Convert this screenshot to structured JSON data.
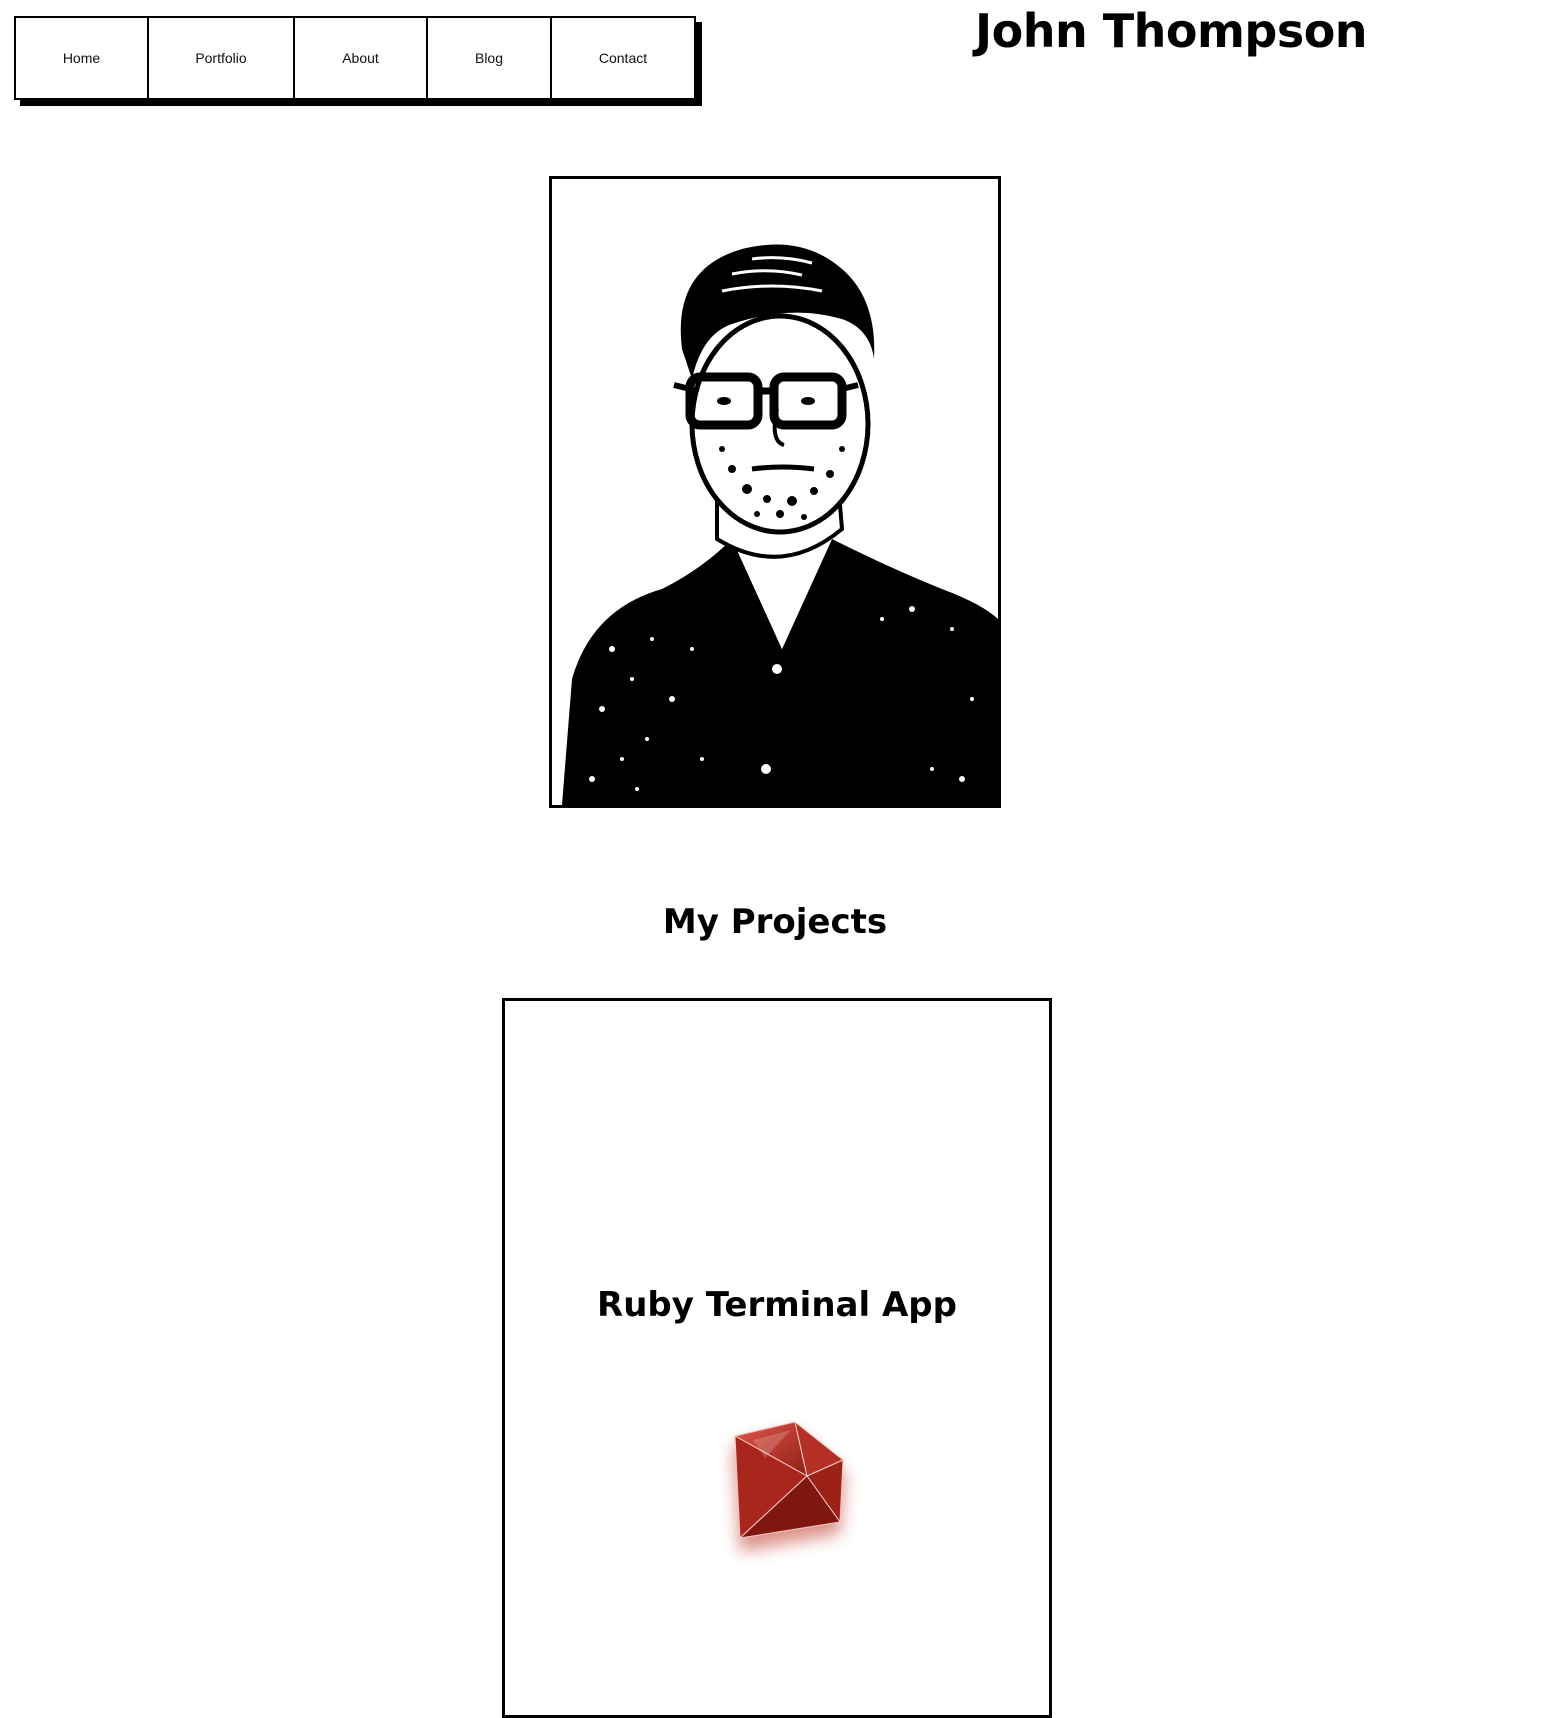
{
  "nav": {
    "items": [
      {
        "label": "Home"
      },
      {
        "label": "Portfolio"
      },
      {
        "label": "About"
      },
      {
        "label": "Blog"
      },
      {
        "label": "Contact"
      }
    ]
  },
  "header": {
    "title": "John Thompson"
  },
  "portrait": {
    "icon": "profile-photo"
  },
  "projects": {
    "heading": "My Projects",
    "items": [
      {
        "title": "Ruby Terminal App",
        "icon": "ruby-gem-icon",
        "accent": "#c0392b"
      }
    ]
  }
}
